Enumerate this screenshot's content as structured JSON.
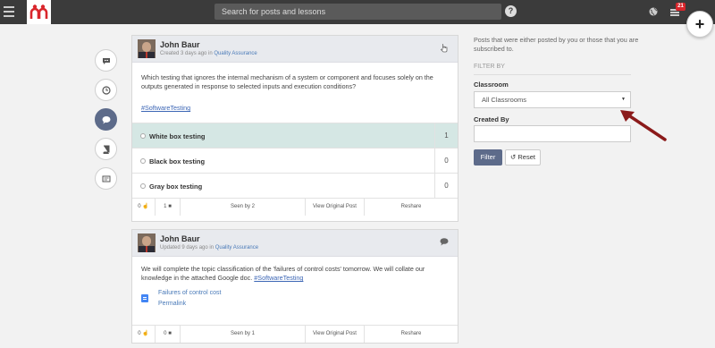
{
  "topbar": {
    "search_placeholder": "Search for posts and lessons",
    "help_label": "?",
    "notification_count": "21",
    "fab_label": "+"
  },
  "posts": [
    {
      "author": "John Baur",
      "meta_prefix": "Created 3 days ago in",
      "meta_classroom": "Quality Assurance",
      "body": "Which testing that ignores the internal mechanism of a system or component and focuses solely on the outputs generated in response to selected inputs and execution conditions?",
      "tag": "#SoftwareTesting",
      "options": [
        {
          "label": "White box testing",
          "count": "1",
          "selected": true
        },
        {
          "label": "Black box testing",
          "count": "0",
          "selected": false
        },
        {
          "label": "Gray box testing",
          "count": "0",
          "selected": false
        }
      ],
      "footer": {
        "likes": "0",
        "comments": "1",
        "seen": "Seen by 2",
        "view_original": "View Original Post",
        "reshare": "Reshare"
      }
    },
    {
      "author": "John Baur",
      "meta_prefix": "Updated 9 days ago in",
      "meta_classroom": "Quality Assurance",
      "body": "We will complete the topic classification of the 'failures of control costs' tomorrow. We will collate our knowledge in the attached Google doc.",
      "tag": "#SoftwareTesting",
      "attachment": {
        "title": "Failures of control cost",
        "permalink": "Permalink"
      },
      "footer": {
        "likes": "0",
        "comments": "0",
        "seen": "Seen by 1",
        "view_original": "View Original Post",
        "reshare": "Reshare"
      }
    }
  ],
  "filter": {
    "info": "Posts that were either posted by you or those that you are subscribed to.",
    "filter_by": "FILTER BY",
    "classroom_label": "Classroom",
    "classroom_value": "All Classrooms",
    "created_by_label": "Created By",
    "created_by_value": "",
    "filter_button": "Filter",
    "reset_button": "Reset"
  },
  "colors": {
    "topbar": "#3b3b3b",
    "accent": "#5d6b8a",
    "selected_option": "#d5e7e4",
    "arrow": "#8b1a1a",
    "badge": "#d9262c"
  }
}
